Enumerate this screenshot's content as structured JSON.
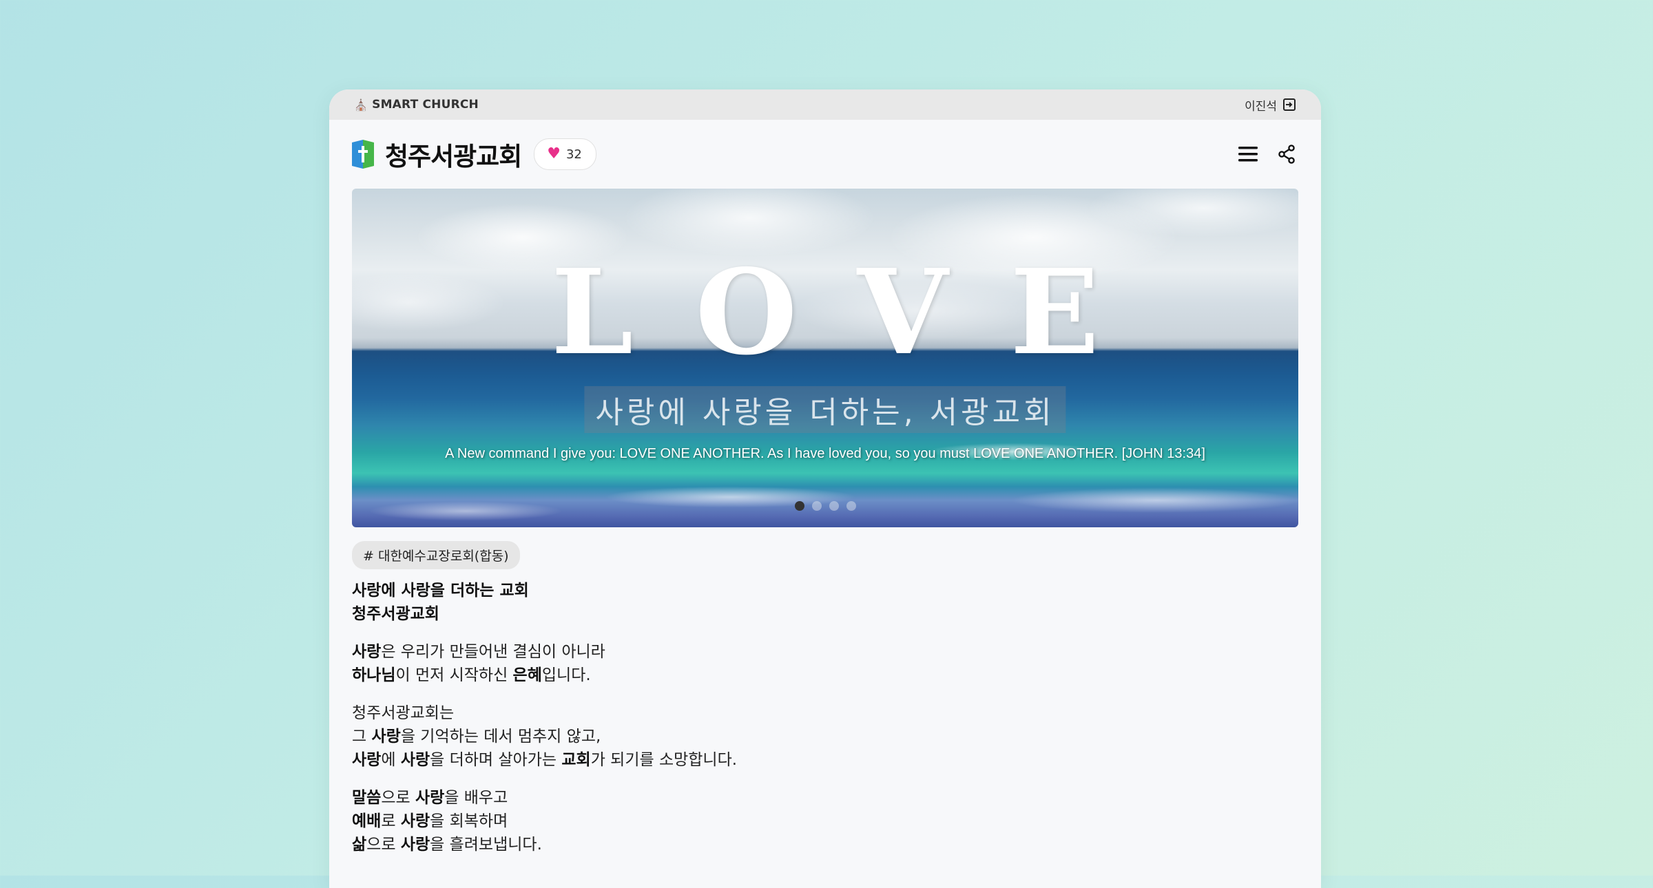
{
  "topbar": {
    "brand": "SMART CHURCH",
    "user": "이진석"
  },
  "header": {
    "title": "청주서광교회",
    "likes": "32"
  },
  "banner": {
    "headline": "LOVE",
    "tagline": "사랑에 사랑을 더하는, 서광교회",
    "verse": "A New command I give you: LOVE ONE ANOTHER. As I have loved you, so you must LOVE ONE ANOTHER. [JOHN 13:34]",
    "slides": 4,
    "active_slide": 1
  },
  "tag": "# 대한예수교장로회(합동)",
  "intro": {
    "p1": [
      {
        "b": "사랑에 사랑을 더하는 교회"
      },
      {
        "b": "청주서광교회"
      }
    ],
    "p2": [
      [
        {
          "b": "사랑"
        },
        {
          "t": "은 우리가 만들어낸 결심이 아니라"
        }
      ],
      [
        {
          "b": "하나님"
        },
        {
          "t": "이 먼저 시작하신 "
        },
        {
          "b": "은혜"
        },
        {
          "t": "입니다."
        }
      ]
    ],
    "p3": [
      [
        {
          "t": "청주서광교회는"
        }
      ],
      [
        {
          "t": "그 "
        },
        {
          "b": "사랑"
        },
        {
          "t": "을 기억하는 데서 멈추지 않고,"
        }
      ],
      [
        {
          "b": "사랑"
        },
        {
          "t": "에 "
        },
        {
          "b": "사랑"
        },
        {
          "t": "을 더하며 살아가는 "
        },
        {
          "b": "교회"
        },
        {
          "t": "가 되기를 소망합니다."
        }
      ]
    ],
    "p4": [
      [
        {
          "b": "말씀"
        },
        {
          "t": "으로 "
        },
        {
          "b": "사랑"
        },
        {
          "t": "을 배우고"
        }
      ],
      [
        {
          "b": "예배"
        },
        {
          "t": "로 "
        },
        {
          "b": "사랑"
        },
        {
          "t": "을 회복하며"
        }
      ],
      [
        {
          "b": "삶"
        },
        {
          "t": "으로 "
        },
        {
          "b": "사랑"
        },
        {
          "t": "을 흘려보냅니다."
        }
      ]
    ]
  }
}
